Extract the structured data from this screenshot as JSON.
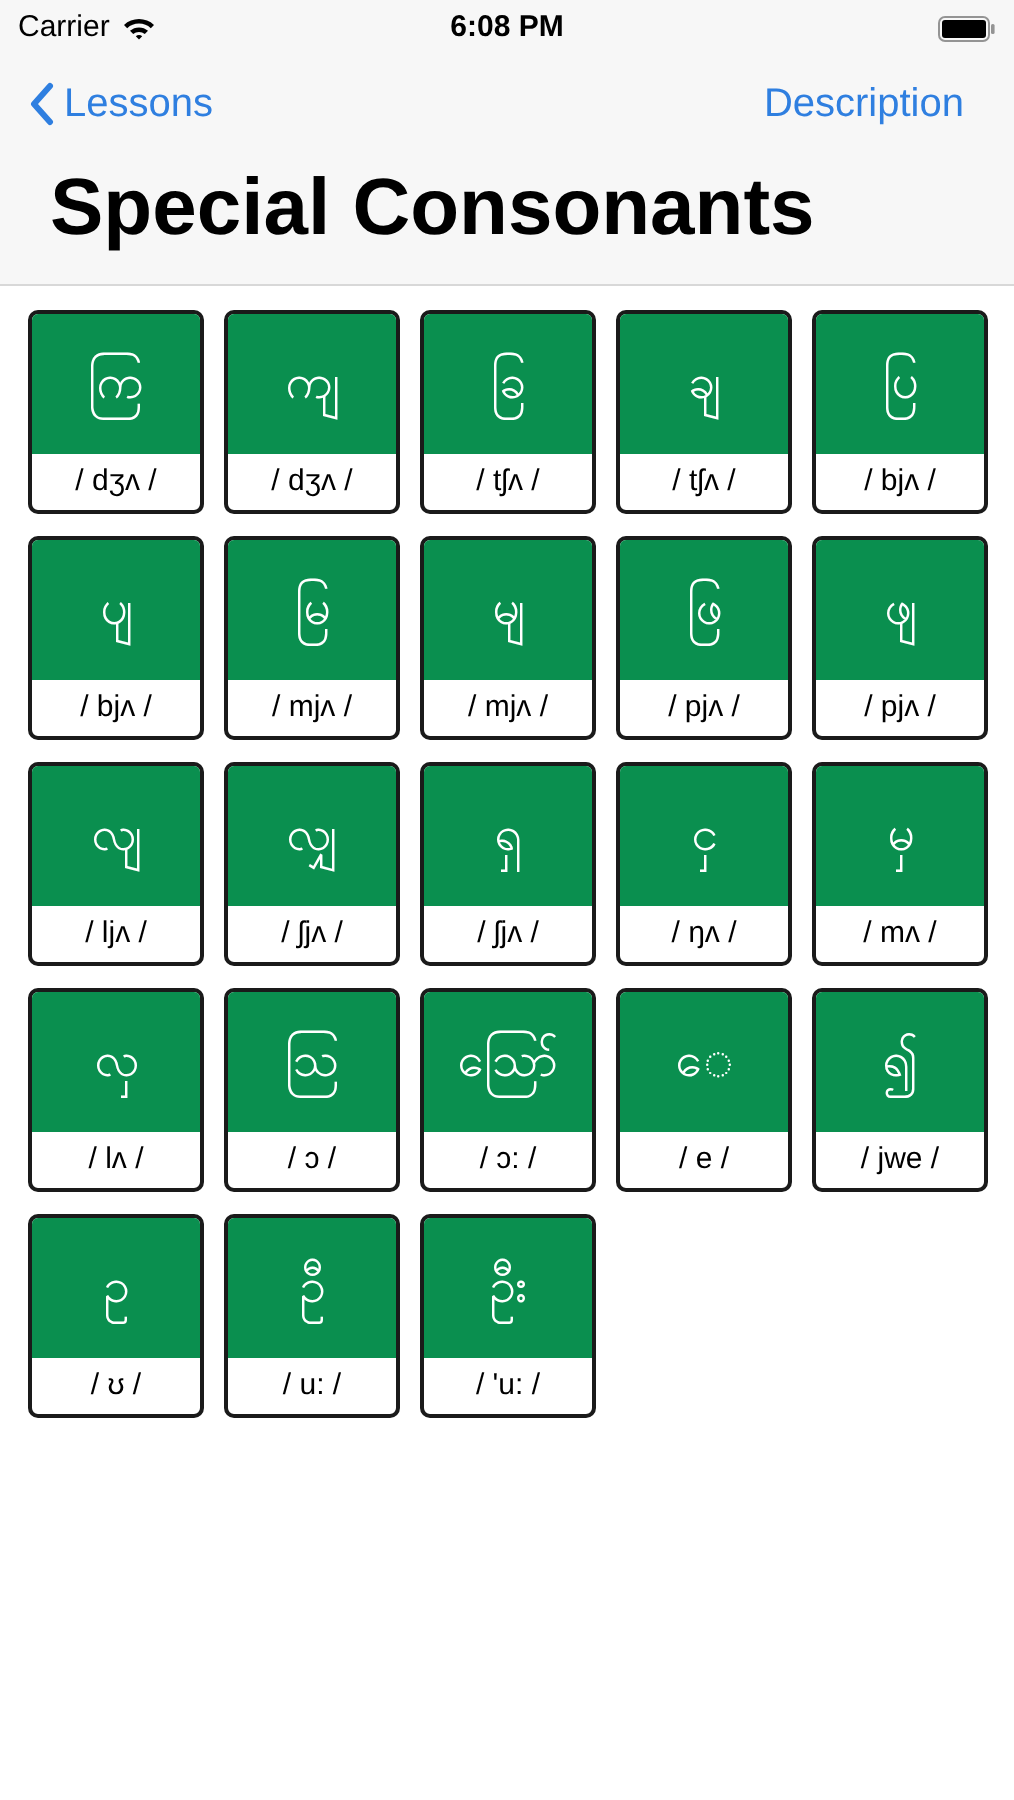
{
  "status_bar": {
    "carrier": "Carrier",
    "time": "6:08 PM"
  },
  "nav": {
    "back": "Lessons",
    "action": "Description",
    "title": "Special Consonants"
  },
  "cards": [
    {
      "glyph": "ကြ",
      "sound": "/ dʒʌ /"
    },
    {
      "glyph": "ကျ",
      "sound": "/ dʒʌ /"
    },
    {
      "glyph": "ခြ",
      "sound": "/ tʃʌ /"
    },
    {
      "glyph": "ချ",
      "sound": "/ tʃʌ /"
    },
    {
      "glyph": "ပြ",
      "sound": "/ bjʌ /"
    },
    {
      "glyph": "ပျ",
      "sound": "/ bjʌ /"
    },
    {
      "glyph": "မြ",
      "sound": "/ mjʌ /"
    },
    {
      "glyph": "မျ",
      "sound": "/ mjʌ /"
    },
    {
      "glyph": "ဖြ",
      "sound": "/ pjʌ /"
    },
    {
      "glyph": "ဖျ",
      "sound": "/ pjʌ /"
    },
    {
      "glyph": "လျ",
      "sound": "/ ljʌ /"
    },
    {
      "glyph": "လျှ",
      "sound": "/ ʃjʌ /"
    },
    {
      "glyph": "ရှ",
      "sound": "/ ʃjʌ /"
    },
    {
      "glyph": "ငှ",
      "sound": "/ ŋʌ /"
    },
    {
      "glyph": "မှ",
      "sound": "/ mʌ /"
    },
    {
      "glyph": "လှ",
      "sound": "/ lʌ /"
    },
    {
      "glyph": "ဩ",
      "sound": "/ ɔ /"
    },
    {
      "glyph": "ဪ",
      "sound": "/ ɔ: /"
    },
    {
      "glyph": "ေ",
      "sound": "/ e /"
    },
    {
      "glyph": "၍",
      "sound": "/ jwe /"
    },
    {
      "glyph": "ဥ",
      "sound": "/ ʊ /"
    },
    {
      "glyph": "ဦ",
      "sound": "/ u: /"
    },
    {
      "glyph": "ဦး",
      "sound": "/ 'u: /"
    }
  ]
}
